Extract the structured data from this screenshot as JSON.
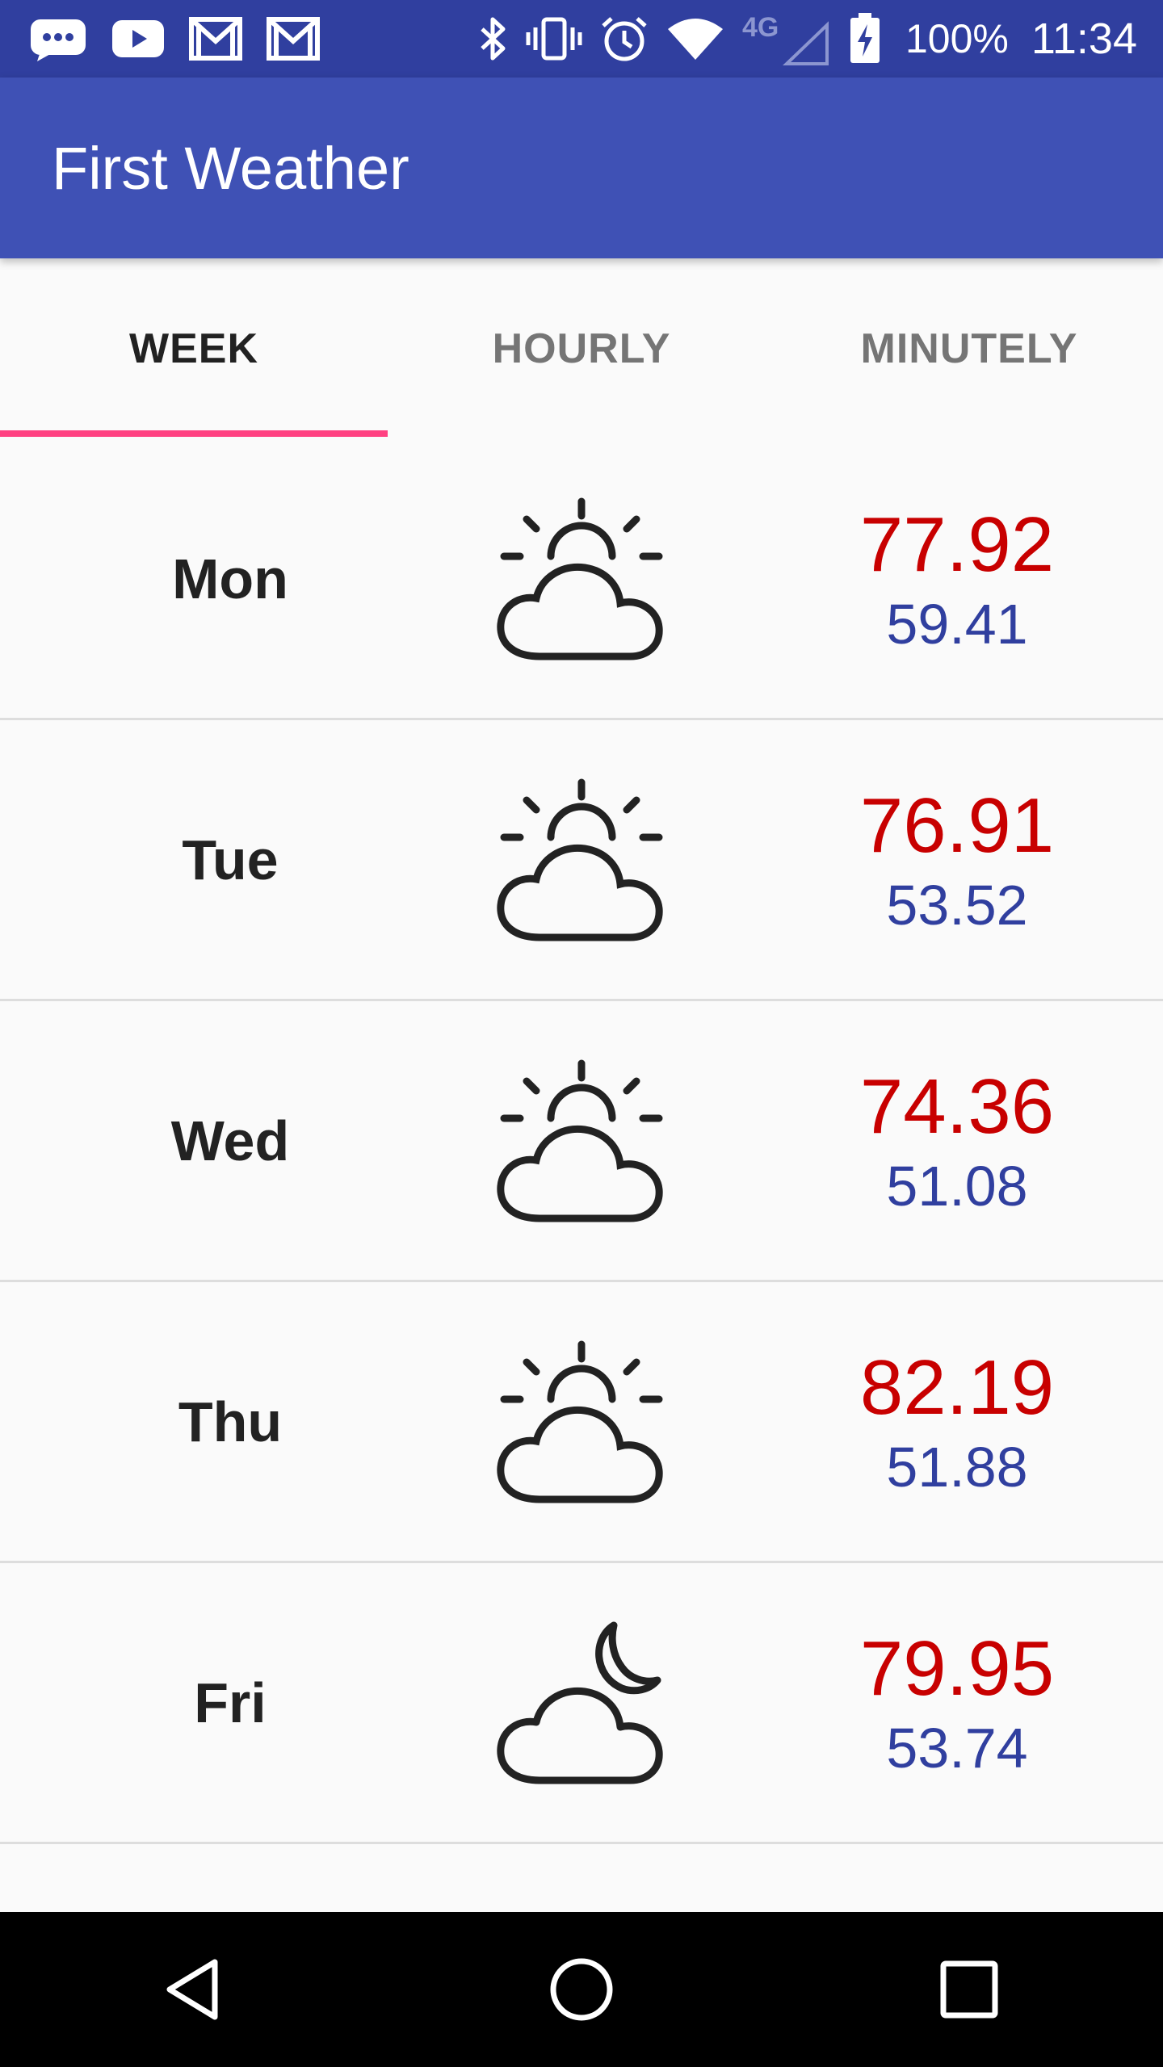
{
  "status_bar": {
    "network": "4G",
    "battery": "100%",
    "time": "11:34"
  },
  "app_bar": {
    "title": "First Weather"
  },
  "tabs": [
    {
      "label": "WEEK",
      "active": true
    },
    {
      "label": "HOURLY",
      "active": false
    },
    {
      "label": "MINUTELY",
      "active": false
    }
  ],
  "days": [
    {
      "day": "Mon",
      "icon": "partly-cloudy-day-icon",
      "high": "77.92",
      "low": "59.41"
    },
    {
      "day": "Tue",
      "icon": "partly-cloudy-day-icon",
      "high": "76.91",
      "low": "53.52"
    },
    {
      "day": "Wed",
      "icon": "partly-cloudy-day-icon",
      "high": "74.36",
      "low": "51.08"
    },
    {
      "day": "Thu",
      "icon": "partly-cloudy-day-icon",
      "high": "82.19",
      "low": "51.88"
    },
    {
      "day": "Fri",
      "icon": "partly-cloudy-night-icon",
      "high": "79.95",
      "low": "53.74"
    }
  ],
  "colors": {
    "primary": "#3f51b5",
    "primary_dark": "#303f9f",
    "accent": "#ff4081",
    "high_temp": "#c80000",
    "low_temp": "#303f9f"
  }
}
